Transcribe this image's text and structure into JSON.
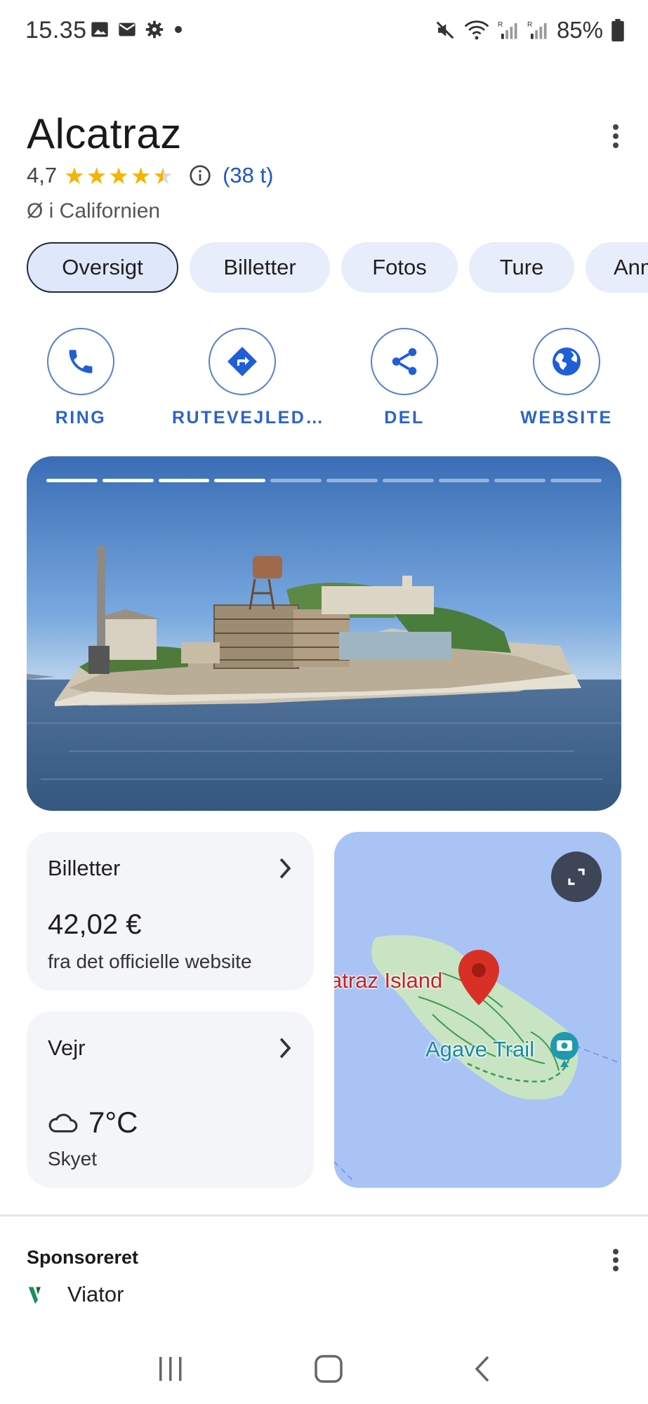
{
  "status_bar": {
    "time": "15.35",
    "battery": "85%"
  },
  "place": {
    "name": "Alcatraz",
    "rating": "4,7",
    "stars": 4.5,
    "reviews": "(38 t)",
    "category": "Ø i Californien"
  },
  "tabs": [
    {
      "label": "Oversigt",
      "active": true
    },
    {
      "label": "Billetter",
      "active": false
    },
    {
      "label": "Fotos",
      "active": false
    },
    {
      "label": "Ture",
      "active": false
    },
    {
      "label": "Anm",
      "active": false
    }
  ],
  "actions": [
    {
      "label": "RING",
      "icon": "phone-icon"
    },
    {
      "label": "RUTEVEJLED…",
      "icon": "directions-icon"
    },
    {
      "label": "DEL",
      "icon": "share-icon"
    },
    {
      "label": "WEBSITE",
      "icon": "globe-icon"
    }
  ],
  "photo_carousel": {
    "total": 10,
    "current": 4
  },
  "tickets_card": {
    "title": "Billetter",
    "price": "42,02 €",
    "source": "fra det officielle website"
  },
  "weather_card": {
    "title": "Vejr",
    "temperature": "7°C",
    "condition": "Skyet"
  },
  "map": {
    "label_island": "atraz Island",
    "label_trail": "Agave Trail"
  },
  "sponsored": {
    "heading": "Sponsoreret",
    "advertiser": "Viator"
  },
  "colors": {
    "accent": "#1a56c9",
    "star": "#f4b400",
    "chip_bg": "#e8edfb",
    "map_bg": "#a9c3f5",
    "pin": "#d93025"
  }
}
